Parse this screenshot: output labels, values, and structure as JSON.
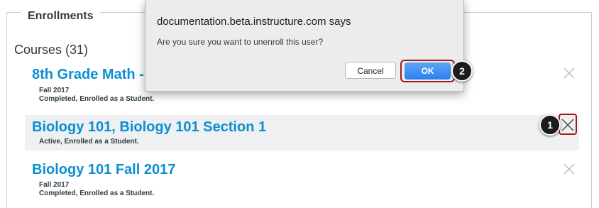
{
  "panel": {
    "title": "Enrollments"
  },
  "courses": {
    "heading": "Courses (31)",
    "items": [
      {
        "title": "8th Grade Math -",
        "term": "Fall 2017",
        "status": "Completed, Enrolled as a Student."
      },
      {
        "title": "Biology 101, Biology 101 Section 1",
        "term": "",
        "status": "Active, Enrolled as a Student."
      },
      {
        "title": "Biology 101 Fall 2017",
        "term": "Fall 2017",
        "status": "Completed, Enrolled as a Student."
      }
    ]
  },
  "dialog": {
    "title": "documentation.beta.instructure.com says",
    "message": "Are you sure you want to unenroll this user?",
    "cancel_label": "Cancel",
    "ok_label": "OK"
  },
  "callouts": {
    "first": "1",
    "second": "2"
  },
  "colors": {
    "link": "#0b8fd1",
    "highlight_outline": "#9e1b20",
    "ok_button": "#2b7ff0"
  }
}
